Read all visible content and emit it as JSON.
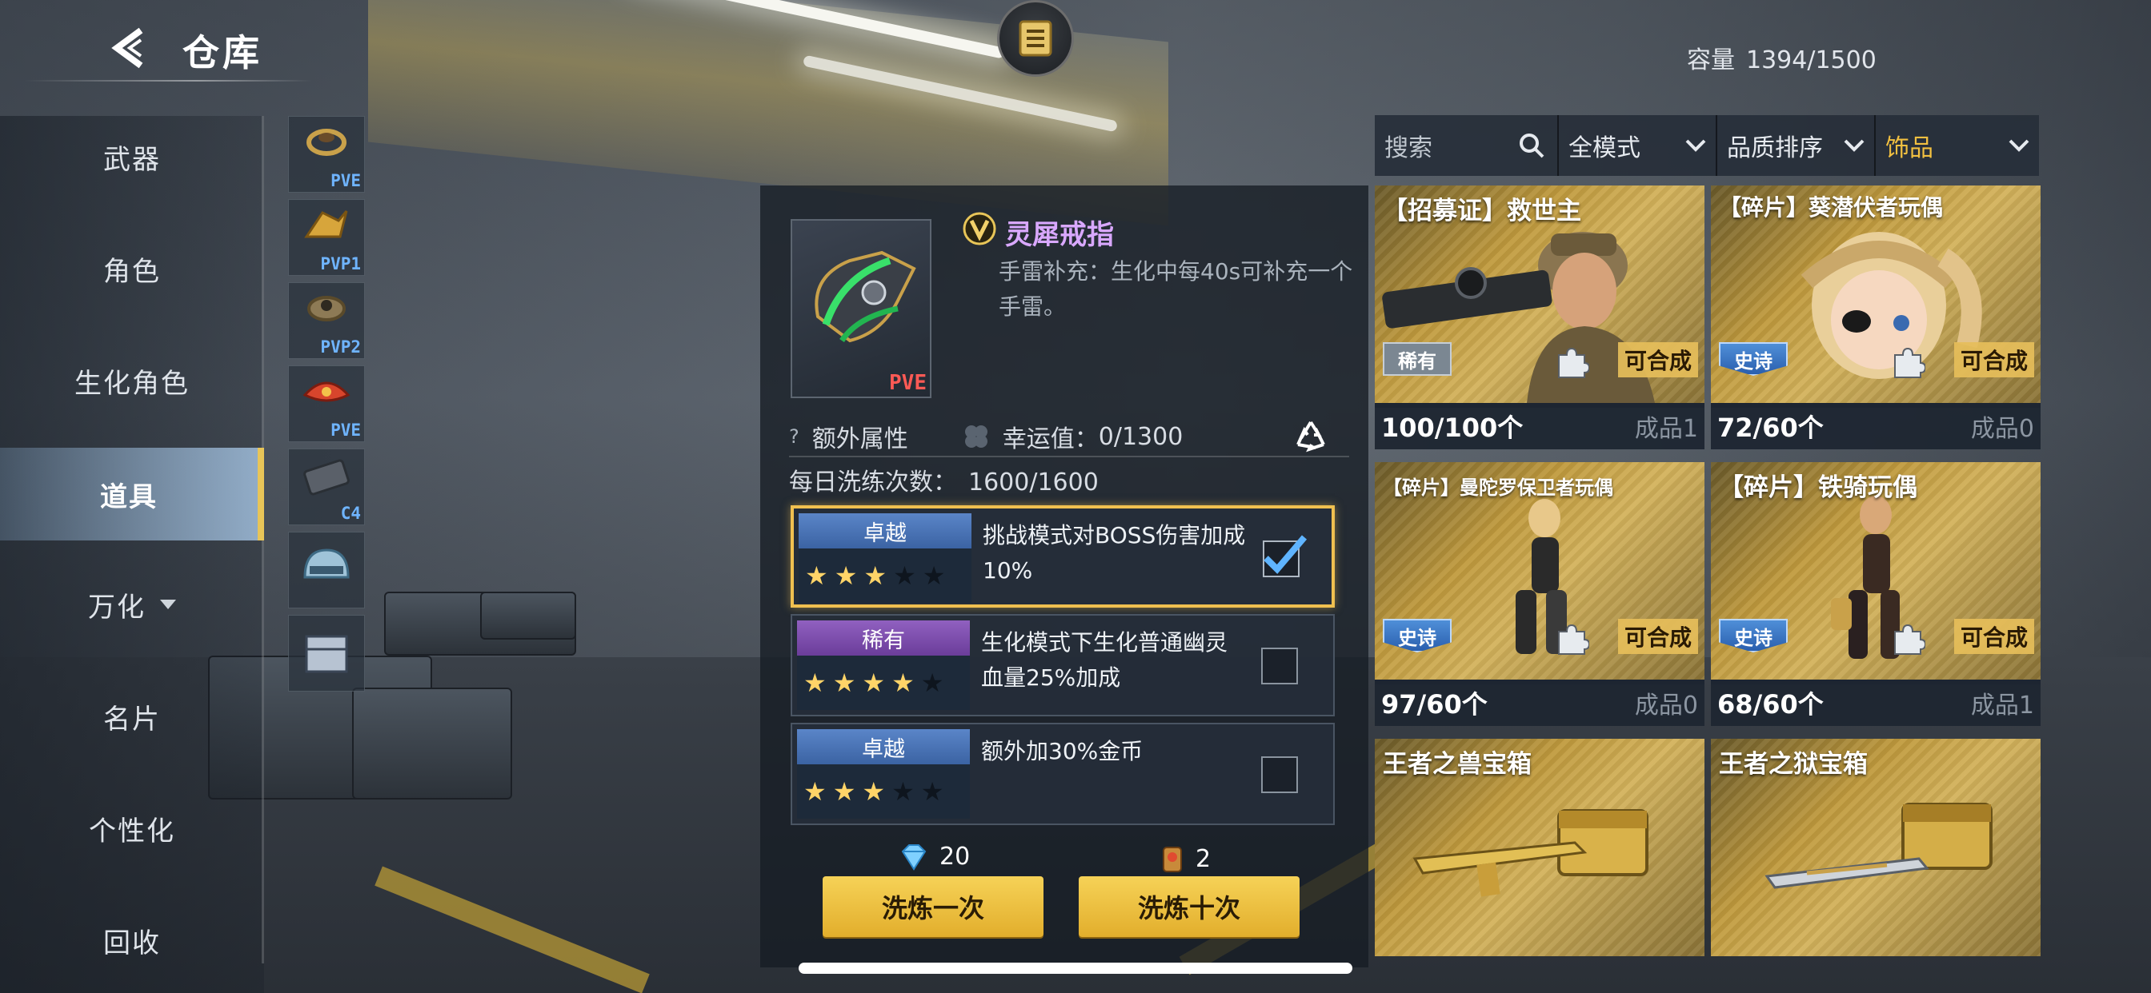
{
  "header": {
    "title": "仓库",
    "capacity_label": "容量",
    "capacity_value": "1394/1500"
  },
  "leftnav": {
    "items": [
      {
        "label": "武器"
      },
      {
        "label": "角色"
      },
      {
        "label": "生化角色"
      },
      {
        "label": "道具"
      },
      {
        "label": "万化"
      },
      {
        "label": "名片"
      },
      {
        "label": "个性化"
      },
      {
        "label": "回收"
      }
    ],
    "active": "道具"
  },
  "substrip": {
    "slots": [
      {
        "tag": "PVE",
        "icon": "ring-icon"
      },
      {
        "tag": "PVP1",
        "icon": "ring-icon"
      },
      {
        "tag": "PVP2",
        "icon": "ring-icon"
      },
      {
        "tag": "PVE",
        "icon": "ring-icon"
      },
      {
        "tag": "C4",
        "icon": "c4-icon"
      },
      {
        "tag": "",
        "icon": "helmet-icon"
      },
      {
        "tag": "",
        "icon": "box-icon"
      }
    ]
  },
  "detail": {
    "item_name": "灵犀戒指",
    "item_tag": "PVE",
    "description": "手雷补充：生化中每40s可补充一个手雷。",
    "extra_attr_label": "额外属性",
    "luck_label": "幸运值：",
    "luck_value": "0/1300",
    "daily_label": "每日洗练次数：",
    "daily_value": "1600/1600",
    "attributes": [
      {
        "quality": "卓越",
        "color": "#4d78bd",
        "stars": 3,
        "max_stars": 5,
        "text": "挑战模式对BOSS伤害加成10%",
        "checked": true
      },
      {
        "quality": "稀有",
        "color": "#8455b5",
        "stars": 4,
        "max_stars": 5,
        "text": "生化模式下生化普通幽灵血量25%加成",
        "checked": false
      },
      {
        "quality": "卓越",
        "color": "#4d78bd",
        "stars": 3,
        "max_stars": 5,
        "text": "额外加30%金币",
        "checked": false
      }
    ],
    "cost_once": "20",
    "cost_ten": "2",
    "refine_once_label": "洗炼一次",
    "refine_ten_label": "洗炼十次"
  },
  "filters": {
    "search_placeholder": "搜索",
    "mode": "全模式",
    "sort": "品质排序",
    "category": "饰品"
  },
  "inventory": [
    {
      "name": "【招募证】救世主",
      "rarity": "稀有",
      "combinable": "可合成",
      "count": "100/100个",
      "made": "成品1",
      "name_size": "large"
    },
    {
      "name": "【碎片】葵潜伏者玩偶",
      "rarity": "史诗",
      "combinable": "可合成",
      "count": "72/60个",
      "made": "成品0",
      "name_size": "medium"
    },
    {
      "name": "【碎片】曼陀罗保卫者玩偶",
      "rarity": "史诗",
      "combinable": "可合成",
      "count": "97/60个",
      "made": "成品0",
      "name_size": "small"
    },
    {
      "name": "【碎片】铁骑玩偶",
      "rarity": "史诗",
      "combinable": "可合成",
      "count": "68/60个",
      "made": "成品1",
      "name_size": "large"
    },
    {
      "name": "王者之兽宝箱",
      "rarity": "",
      "combinable": "",
      "count": "",
      "made": "",
      "name_size": "large"
    },
    {
      "name": "王者之狱宝箱",
      "rarity": "",
      "combinable": "",
      "count": "",
      "made": "",
      "name_size": "large"
    }
  ],
  "colors": {
    "accent_gold": "#f2c040",
    "button_gold": "#f6d257",
    "epic_blue": "#2a5fae",
    "rare_gray": "#7b8792",
    "item_name_purple": "#d9a8ff"
  }
}
